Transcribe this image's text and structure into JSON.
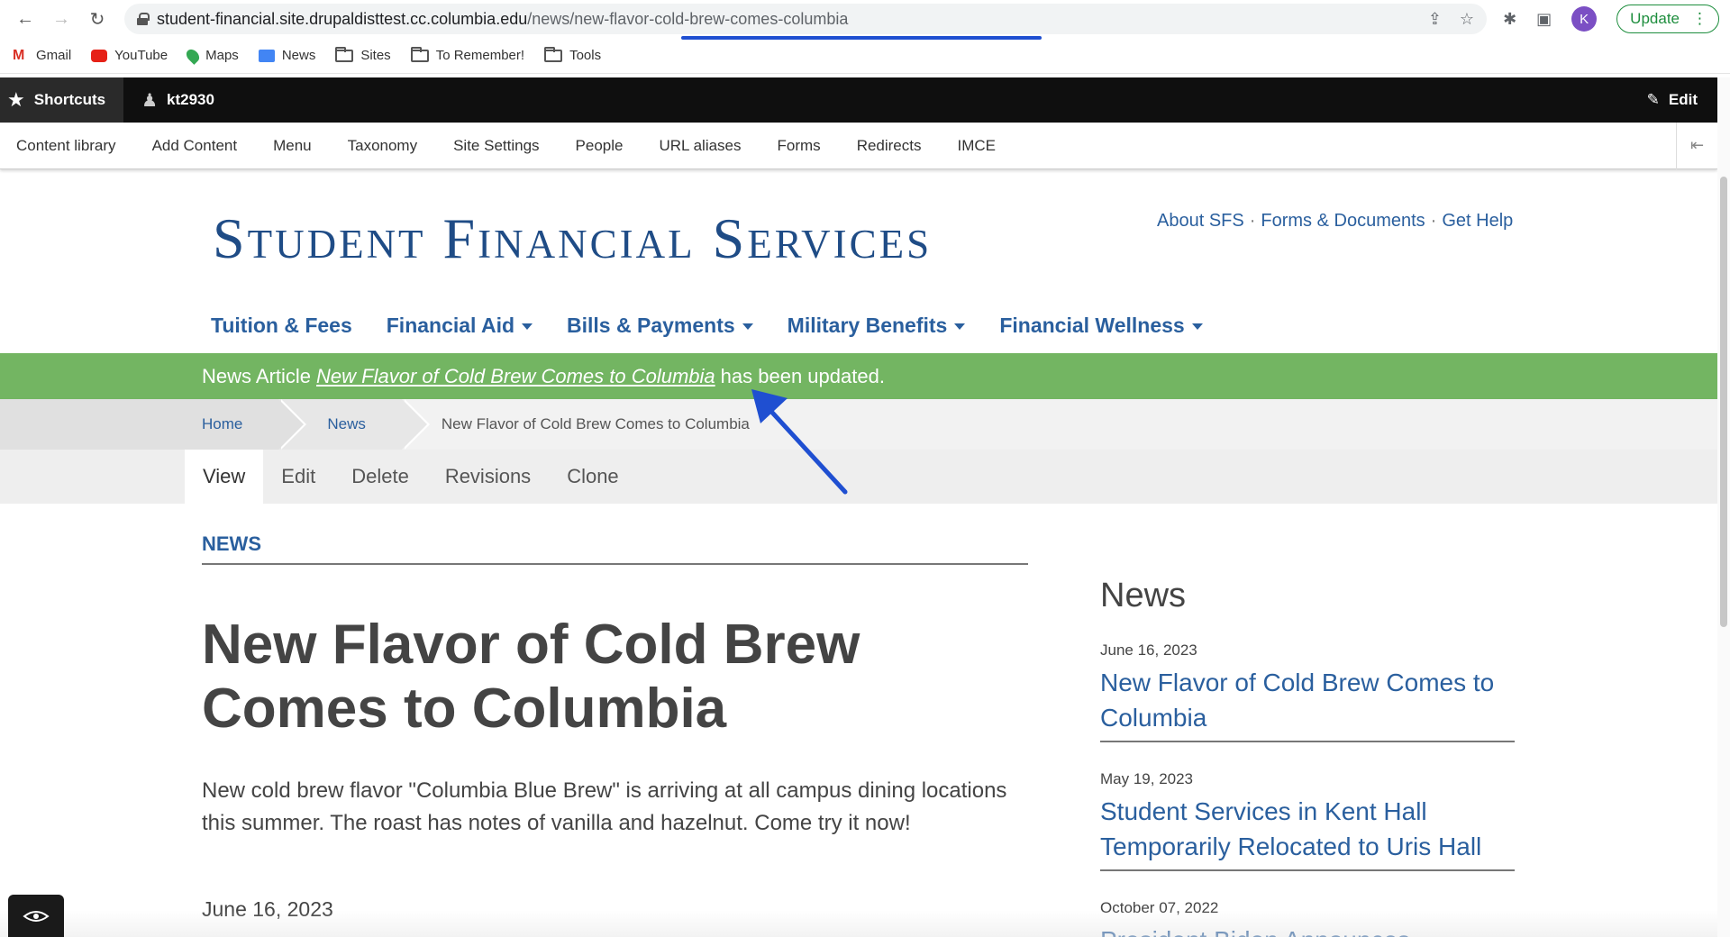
{
  "browser": {
    "url_host": "student-financial.site.drupaldisttest.cc.columbia.edu",
    "url_path": "/news/new-flavor-cold-brew-comes-columbia",
    "profile_initial": "K",
    "update_label": "Update",
    "bookmarks": [
      {
        "label": "Gmail",
        "icon": "gmail-icon"
      },
      {
        "label": "YouTube",
        "icon": "youtube-icon"
      },
      {
        "label": "Maps",
        "icon": "maps-icon"
      },
      {
        "label": "News",
        "icon": "news-icon"
      },
      {
        "label": "Sites",
        "icon": "folder-icon"
      },
      {
        "label": "To Remember!",
        "icon": "folder-icon"
      },
      {
        "label": "Tools",
        "icon": "folder-icon"
      }
    ]
  },
  "toolbar": {
    "shortcuts_label": "Shortcuts",
    "user_label": "kt2930",
    "edit_label": "Edit",
    "tray": [
      "Content library",
      "Add Content",
      "Menu",
      "Taxonomy",
      "Site Settings",
      "People",
      "URL aliases",
      "Forms",
      "Redirects",
      "IMCE"
    ]
  },
  "site": {
    "title": "Student Financial Services",
    "util_links": [
      "About SFS",
      "Forms & Documents",
      "Get Help"
    ],
    "util_sep": "·",
    "nav": [
      {
        "label": "Tuition & Fees",
        "has_dropdown": false
      },
      {
        "label": "Financial Aid",
        "has_dropdown": true
      },
      {
        "label": "Bills & Payments",
        "has_dropdown": true
      },
      {
        "label": "Military Benefits",
        "has_dropdown": true
      },
      {
        "label": "Financial Wellness",
        "has_dropdown": true
      }
    ]
  },
  "status": {
    "prefix": "News Article",
    "link": "New Flavor of Cold Brew Comes to Columbia",
    "suffix": "has been updated.",
    "color": "#73b562"
  },
  "breadcrumb": {
    "home": "Home",
    "news": "News",
    "current": "New Flavor of Cold Brew Comes to Columbia"
  },
  "tabs": [
    "View",
    "Edit",
    "Delete",
    "Revisions",
    "Clone"
  ],
  "article": {
    "section": "NEWS",
    "title": "New Flavor of Cold Brew Comes to Columbia",
    "body": "New cold brew flavor \"Columbia Blue Brew\" is arriving at all campus dining locations this summer. The roast has notes of vanilla and hazelnut. Come try it now!",
    "date": "June 16, 2023"
  },
  "sidebar": {
    "title": "News",
    "items": [
      {
        "date": "June 16, 2023",
        "title": "New Flavor of Cold Brew Comes to Columbia"
      },
      {
        "date": "May 19, 2023",
        "title": "Student Services in Kent Hall Temporarily Relocated to Uris Hall"
      },
      {
        "date": "October 07, 2022",
        "title": "President Biden Announces"
      }
    ]
  },
  "colors": {
    "brand_blue": "#1f4c86",
    "link_blue": "#2a5f9e",
    "annotation_arrow": "#1f4fd1"
  }
}
